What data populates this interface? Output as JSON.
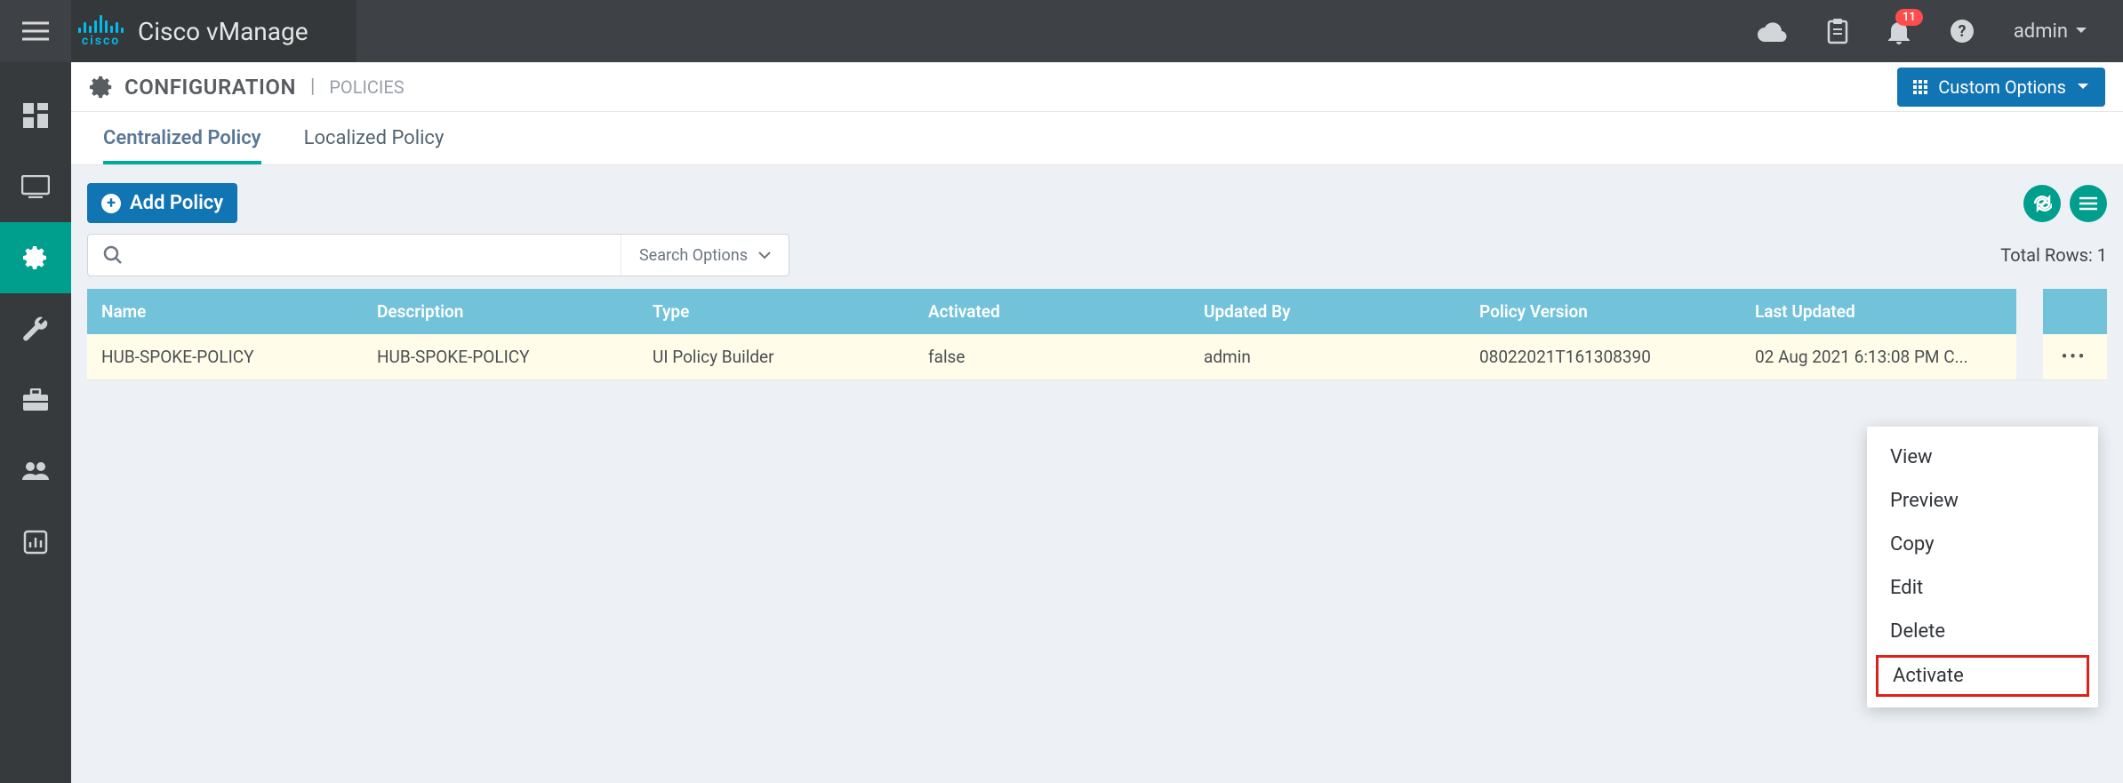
{
  "brand": "Cisco vManage",
  "user": "admin",
  "notif_count": "11",
  "page": {
    "title": "CONFIGURATION",
    "crumb": "POLICIES"
  },
  "custom_options": "Custom Options",
  "tabs": [
    "Centralized Policy",
    "Localized Policy"
  ],
  "add_policy": "Add Policy",
  "search_options": "Search Options",
  "total_rows_label": "Total Rows: 1",
  "headers": {
    "name": "Name",
    "desc": "Description",
    "type": "Type",
    "activated": "Activated",
    "updated_by": "Updated By",
    "policy_version": "Policy Version",
    "last_updated": "Last Updated"
  },
  "row": {
    "name": "HUB-SPOKE-POLICY",
    "desc": "HUB-SPOKE-POLICY",
    "type": "UI Policy Builder",
    "activated": "false",
    "updated_by": "admin",
    "policy_version": "08022021T161308390",
    "last_updated": "02 Aug 2021 6:13:08 PM C..."
  },
  "menu": [
    "View",
    "Preview",
    "Copy",
    "Edit",
    "Delete",
    "Activate"
  ]
}
